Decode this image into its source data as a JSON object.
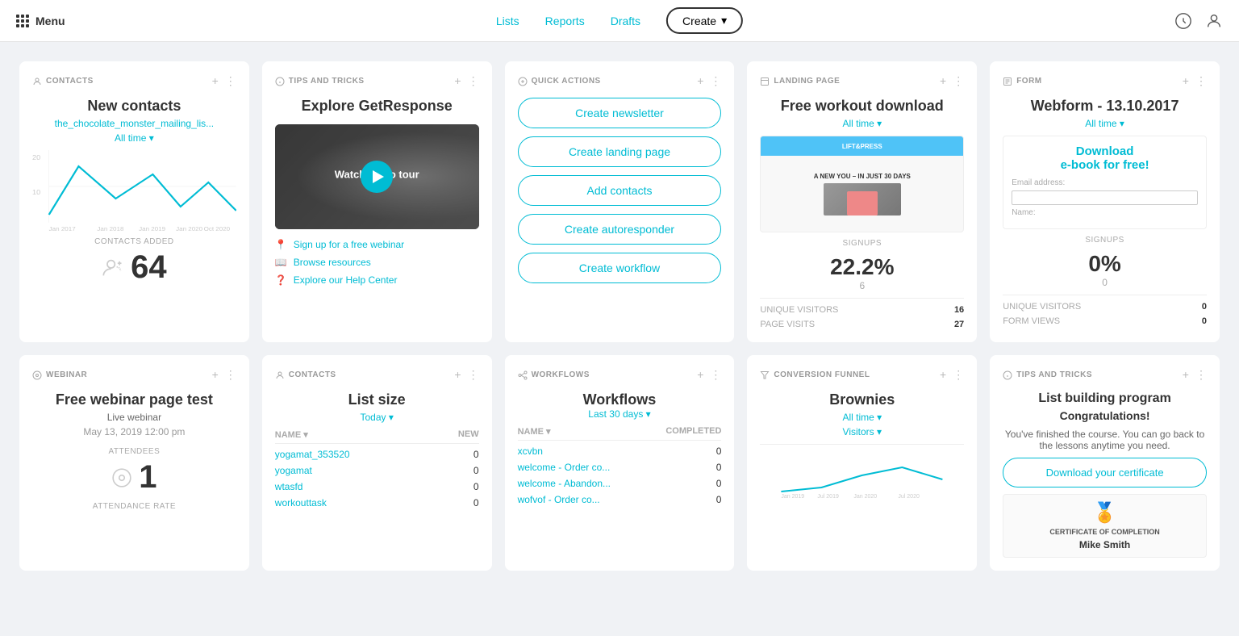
{
  "header": {
    "menu_label": "Menu",
    "nav": {
      "lists": "Lists",
      "reports": "Reports",
      "drafts": "Drafts",
      "create": "Create"
    },
    "icons": [
      "notification-icon",
      "profile-icon"
    ]
  },
  "cards": {
    "contacts": {
      "label": "CONTACTS",
      "title": "New contacts",
      "link": "the_chocolate_monster_mailing_lis...",
      "filter": "All time ▾",
      "chart_values": [
        5,
        18,
        8,
        14,
        6,
        12,
        4
      ],
      "y_labels": [
        "20",
        "10"
      ],
      "x_labels": [
        "Jan 2017",
        "Jan 2018",
        "Jan 2019",
        "Jan 2020",
        "Oct 2020"
      ],
      "contacts_added_label": "CONTACTS ADDED",
      "count": "64"
    },
    "tips": {
      "label": "TIPS AND TRICKS",
      "title": "Explore GetResponse",
      "video_label": "Watch video tour",
      "links": [
        {
          "text": "Sign up for a free webinar",
          "icon": "map-pin-icon"
        },
        {
          "text": "Browse resources",
          "icon": "book-icon"
        },
        {
          "text": "Explore our Help Center",
          "icon": "help-icon"
        }
      ]
    },
    "quick_actions": {
      "label": "QUICK ACTIONS",
      "buttons": [
        "Create newsletter",
        "Create landing page",
        "Add contacts",
        "Create autoresponder",
        "Create workflow"
      ]
    },
    "landing_page": {
      "label": "LANDING PAGE",
      "title": "Free workout download",
      "filter": "All time ▾",
      "signups_label": "SIGNUPS",
      "signups_pct": "22.2%",
      "signups_count": "6",
      "unique_visitors_label": "UNIQUE VISITORS",
      "unique_visitors_val": "16",
      "page_visits_label": "PAGE VISITS",
      "page_visits_val": "27"
    },
    "form": {
      "label": "FORM",
      "title": "Webform - 13.10.2017",
      "filter": "All time ▾",
      "cta": "Download\ne-book for free!",
      "email_label": "Email address:",
      "signups_label": "SIGNUPS",
      "signups_pct": "0%",
      "signups_count": "0",
      "unique_visitors_label": "UNIQUE VISITORS",
      "unique_visitors_val": "0",
      "form_views_label": "FORM VIEWS",
      "form_views_val": "0"
    },
    "webinar": {
      "label": "WEBINAR",
      "title": "Free webinar page test",
      "sub": "Live webinar",
      "date": "May 13, 2019 12:00 pm",
      "attendees_label": "ATTENDEES",
      "attendees_count": "1",
      "attendance_rate_label": "ATTENDANCE RATE"
    },
    "list_size": {
      "label": "CONTACTS",
      "title": "List size",
      "filter": "Today ▾",
      "col_name": "NAME ▾",
      "col_new": "NEW",
      "rows": [
        {
          "name": "yogamat_353520",
          "new": "0"
        },
        {
          "name": "yogamat",
          "new": "0"
        },
        {
          "name": "wtasfd",
          "new": "0"
        },
        {
          "name": "workouttask",
          "new": "0"
        }
      ]
    },
    "workflows": {
      "label": "WORKFLOWS",
      "title": "Workflows",
      "filter": "Last 30 days ▾",
      "col_name": "NAME ▾",
      "col_completed": "COMPLETED",
      "rows": [
        {
          "name": "xcvbn",
          "completed": "0"
        },
        {
          "name": "welcome - Order co...",
          "completed": "0"
        },
        {
          "name": "welcome - Abandon...",
          "completed": "0"
        },
        {
          "name": "wofvof - Order co...",
          "completed": "0"
        }
      ]
    },
    "conversion_funnel": {
      "label": "CONVERSION FUNNEL",
      "title": "Brownies",
      "filter": "All time ▾",
      "sub_filter": "Visitors ▾",
      "x_labels": [
        "Jan 2019",
        "Jul 2019",
        "Jan 2020",
        "Jul 2020"
      ]
    },
    "list_building": {
      "label": "TIPS AND TRICKS",
      "title": "List building program",
      "subtitle": "Congratulations!",
      "desc": "You've finished the course. You can go back to the lessons anytime you need.",
      "download_btn": "Download your certificate",
      "cert_badge": "🏅",
      "cert_title": "CERTIFICATE OF COMPLETION",
      "cert_name": "Mike Smith"
    }
  }
}
